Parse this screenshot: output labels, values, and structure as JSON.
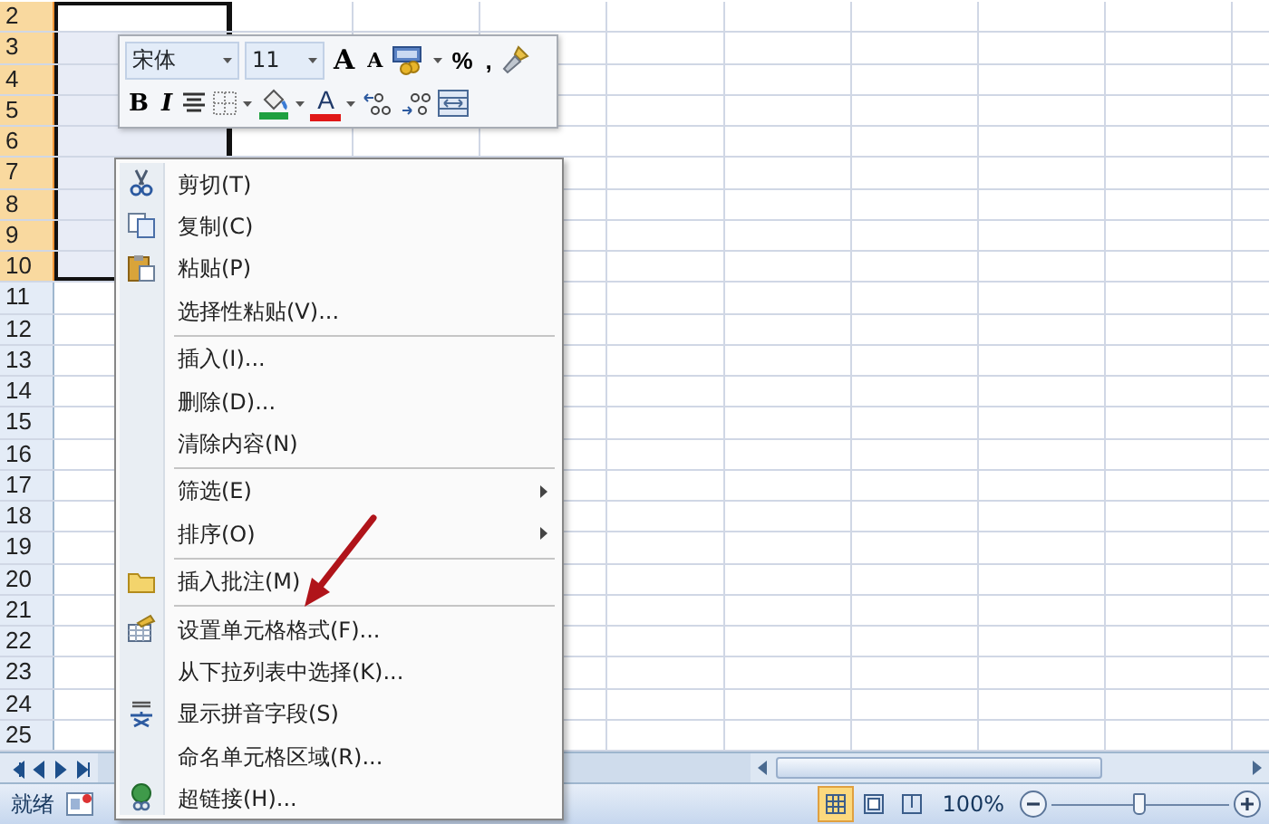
{
  "sheet": {
    "rows": [
      {
        "label": "2",
        "selected": true,
        "active": true
      },
      {
        "label": "3",
        "selected": true,
        "active": false
      },
      {
        "label": "4",
        "selected": true,
        "active": false
      },
      {
        "label": "5",
        "selected": true,
        "active": false
      },
      {
        "label": "6",
        "selected": true,
        "active": false
      },
      {
        "label": "7",
        "selected": true,
        "active": false
      },
      {
        "label": "8",
        "selected": true,
        "active": false
      },
      {
        "label": "9",
        "selected": true,
        "active": false
      },
      {
        "label": "10",
        "selected": true,
        "active": false
      },
      {
        "label": "11",
        "selected": false,
        "active": false
      },
      {
        "label": "12",
        "selected": false,
        "active": false
      },
      {
        "label": "13",
        "selected": false,
        "active": false
      },
      {
        "label": "14",
        "selected": false,
        "active": false
      },
      {
        "label": "15",
        "selected": false,
        "active": false
      },
      {
        "label": "16",
        "selected": false,
        "active": false
      },
      {
        "label": "17",
        "selected": false,
        "active": false
      },
      {
        "label": "18",
        "selected": false,
        "active": false
      },
      {
        "label": "19",
        "selected": false,
        "active": false
      },
      {
        "label": "20",
        "selected": false,
        "active": false
      },
      {
        "label": "21",
        "selected": false,
        "active": false
      },
      {
        "label": "22",
        "selected": false,
        "active": false
      },
      {
        "label": "23",
        "selected": false,
        "active": false
      },
      {
        "label": "24",
        "selected": false,
        "active": false
      },
      {
        "label": "25",
        "selected": false,
        "active": false
      }
    ]
  },
  "mini_toolbar": {
    "upper_group": {
      "items": [
        {
          "kind": "font",
          "text": "宋体"
        },
        {
          "kind": "size",
          "text": "11"
        },
        {
          "kind": "grow",
          "text": "A"
        },
        {
          "kind": "shrink",
          "text": "A"
        },
        {
          "kind": "accounting"
        },
        {
          "kind": "glyph",
          "text": "%"
        },
        {
          "kind": "glyph",
          "text": ","
        },
        {
          "kind": "painter"
        }
      ]
    },
    "lower_group": {
      "items": [
        {
          "kind": "bold",
          "text": "B"
        },
        {
          "kind": "italic",
          "text": "I"
        },
        {
          "kind": "center"
        },
        {
          "kind": "border"
        },
        {
          "kind": "fill"
        },
        {
          "kind": "fontcolor",
          "text": "A"
        },
        {
          "kind": "incdec"
        },
        {
          "kind": "decdec"
        },
        {
          "kind": "merge"
        }
      ]
    }
  },
  "context_menu": {
    "items": [
      {
        "label": "剪切(T)",
        "submenu": false,
        "separator_after": false
      },
      {
        "label": "复制(C)",
        "submenu": false,
        "separator_after": false
      },
      {
        "label": "粘贴(P)",
        "submenu": false,
        "separator_after": false
      },
      {
        "label": "选择性粘贴(V)...",
        "submenu": false,
        "separator_after": true
      },
      {
        "label": "插入(I)...",
        "submenu": false,
        "separator_after": false
      },
      {
        "label": "删除(D)...",
        "submenu": false,
        "separator_after": false
      },
      {
        "label": "清除内容(N)",
        "submenu": false,
        "separator_after": true
      },
      {
        "label": "筛选(E)",
        "submenu": true,
        "separator_after": false
      },
      {
        "label": "排序(O)",
        "submenu": true,
        "separator_after": true
      },
      {
        "label": "插入批注(M)",
        "submenu": false,
        "separator_after": true
      },
      {
        "label": "设置单元格格式(F)...",
        "submenu": false,
        "separator_after": false
      },
      {
        "label": "从下拉列表中选择(K)...",
        "submenu": false,
        "separator_after": false
      },
      {
        "label": "显示拼音字段(S)",
        "submenu": false,
        "separator_after": false
      },
      {
        "label": "命名单元格区域(R)...",
        "submenu": false,
        "separator_after": false
      },
      {
        "label": "超链接(H)...",
        "submenu": false,
        "separator_after": false
      }
    ]
  },
  "status_bar": {
    "status": "就绪",
    "views": [
      {
        "selected": true
      },
      {
        "selected": false
      },
      {
        "selected": false
      }
    ],
    "zoom": "100%",
    "zoom_slider": {
      "level": 0.5
    }
  }
}
